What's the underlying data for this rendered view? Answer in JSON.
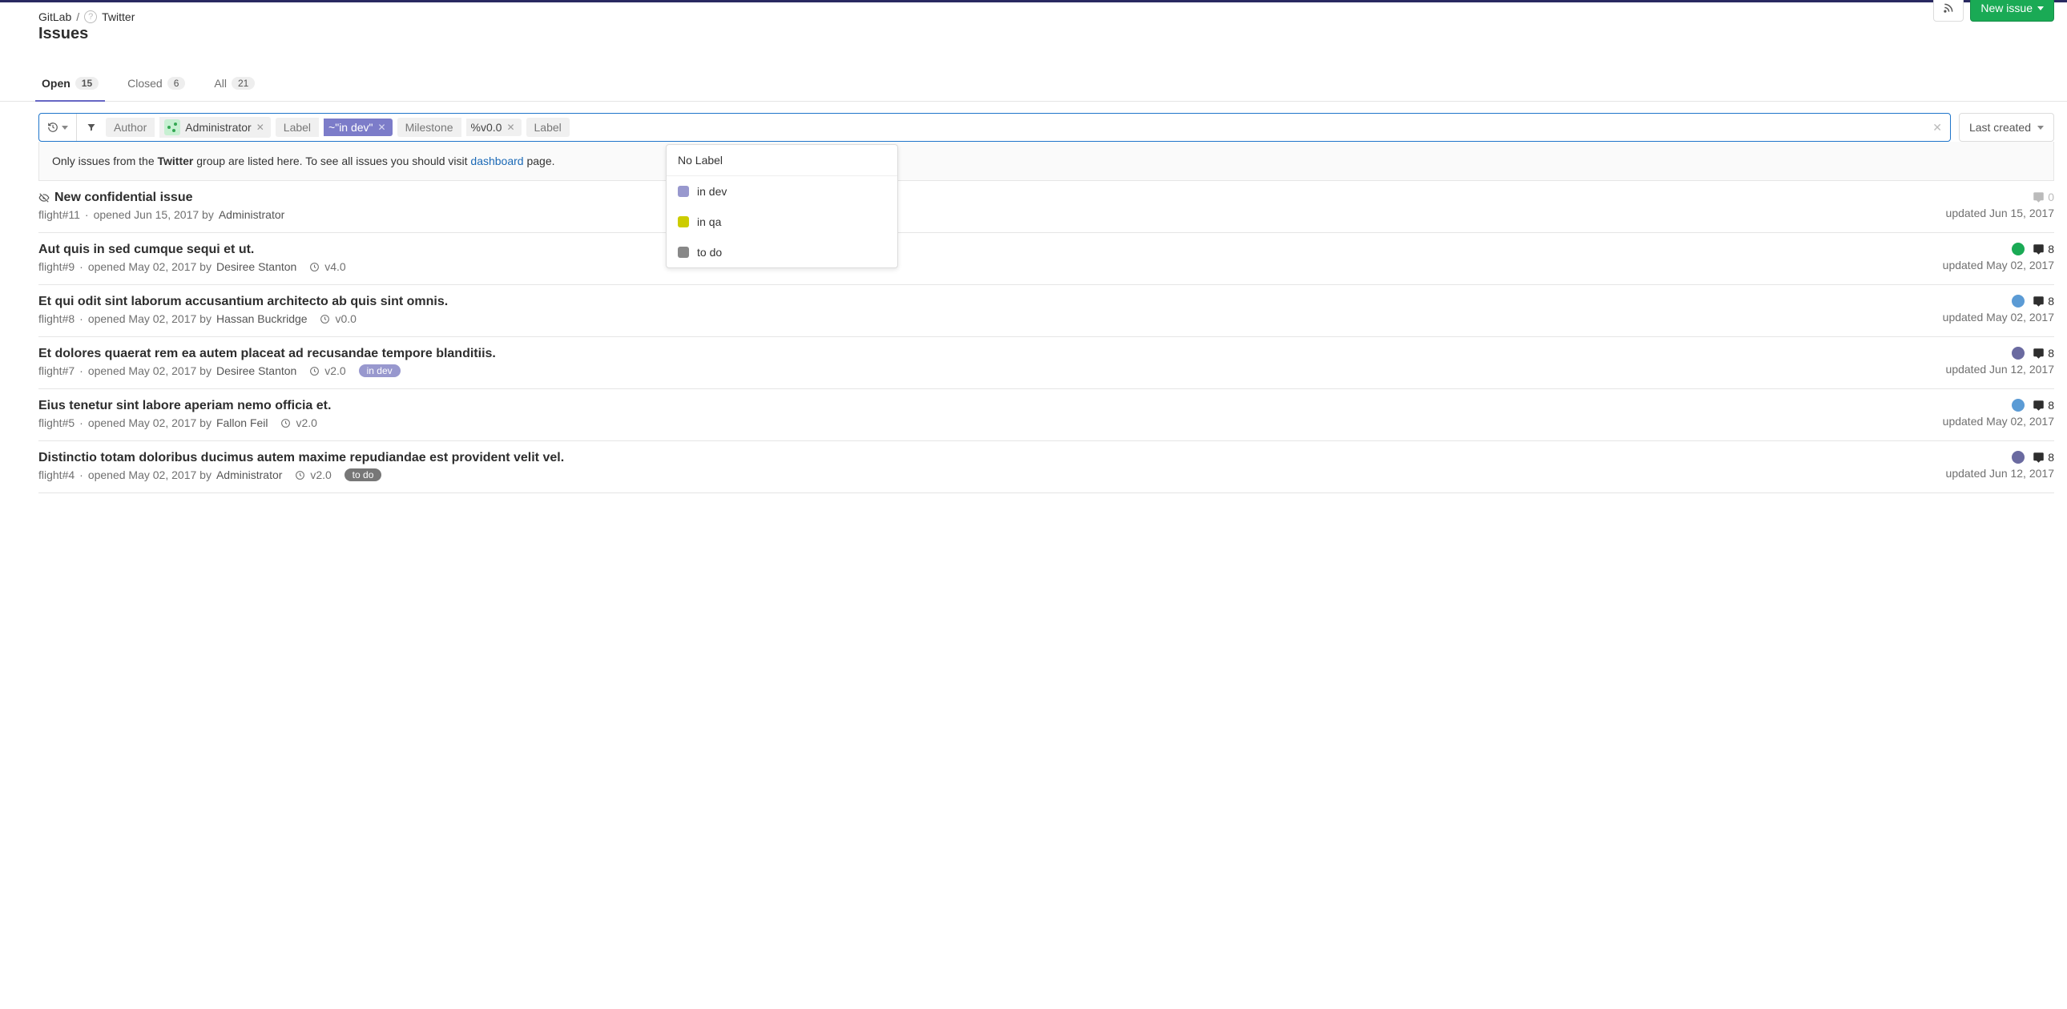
{
  "breadcrumb": {
    "root": "GitLab",
    "group": "Twitter"
  },
  "page_title": "Issues",
  "header_actions": {
    "new_issue": "New issue"
  },
  "tabs": [
    {
      "label": "Open",
      "count": "15",
      "active": true
    },
    {
      "label": "Closed",
      "count": "6",
      "active": false
    },
    {
      "label": "All",
      "count": "21",
      "active": false
    }
  ],
  "filter": {
    "tokens": [
      {
        "label": "Author",
        "value": "Administrator",
        "style": "avatar"
      },
      {
        "label": "Label",
        "value": "~\"in dev\"",
        "style": "purple"
      },
      {
        "label": "Milestone",
        "value": "%v0.0",
        "style": "plain"
      }
    ],
    "trailing_label": "Label",
    "sort": "Last created"
  },
  "dropdown": {
    "nolabel": "No Label",
    "items": [
      {
        "color": "#9898ce",
        "label": "in dev"
      },
      {
        "color": "#cccc00",
        "label": "in qa"
      },
      {
        "color": "#888888",
        "label": "to do"
      }
    ]
  },
  "notice": {
    "pre": "Only issues from the ",
    "bold": "Twitter",
    "mid": " group are listed here. To see all issues you should visit ",
    "link": "dashboard",
    "post": " page."
  },
  "issues": [
    {
      "confidential": true,
      "title": "New confidential issue",
      "ref": "flight#11",
      "opened": "opened Jun 15, 2017 by",
      "author": "Administrator",
      "milestone": "",
      "labels": [],
      "comments": "0",
      "updated": "updated Jun 15, 2017",
      "assignee": "",
      "comment_color": "#bbb"
    },
    {
      "confidential": false,
      "title": "Aut quis in sed cumque sequi et ut.",
      "ref": "flight#9",
      "opened": "opened May 02, 2017 by",
      "author": "Desiree Stanton",
      "milestone": "v4.0",
      "labels": [],
      "comments": "8",
      "updated": "updated May 02, 2017",
      "assignee": "#1aaa55",
      "comment_color": "#2e2e2e"
    },
    {
      "confidential": false,
      "title": "Et qui odit sint laborum accusantium architecto ab quis sint omnis.",
      "ref": "flight#8",
      "opened": "opened May 02, 2017 by",
      "author": "Hassan Buckridge",
      "milestone": "v0.0",
      "labels": [],
      "comments": "8",
      "updated": "updated May 02, 2017",
      "assignee": "#5b9bd5",
      "comment_color": "#2e2e2e"
    },
    {
      "confidential": false,
      "title": "Et dolores quaerat rem ea autem placeat ad recusandae tempore blanditiis.",
      "ref": "flight#7",
      "opened": "opened May 02, 2017 by",
      "author": "Desiree Stanton",
      "milestone": "v2.0",
      "labels": [
        "in dev"
      ],
      "comments": "8",
      "updated": "updated Jun 12, 2017",
      "assignee": "#6a6aa0",
      "comment_color": "#2e2e2e"
    },
    {
      "confidential": false,
      "title": "Eius tenetur sint labore aperiam nemo officia et.",
      "ref": "flight#5",
      "opened": "opened May 02, 2017 by",
      "author": "Fallon Feil",
      "milestone": "v2.0",
      "labels": [],
      "comments": "8",
      "updated": "updated May 02, 2017",
      "assignee": "#5b9bd5",
      "comment_color": "#2e2e2e"
    },
    {
      "confidential": false,
      "title": "Distinctio totam doloribus ducimus autem maxime repudiandae est provident velit vel.",
      "ref": "flight#4",
      "opened": "opened May 02, 2017 by",
      "author": "Administrator",
      "milestone": "v2.0",
      "labels": [
        "to do"
      ],
      "comments": "8",
      "updated": "updated Jun 12, 2017",
      "assignee": "#6a6aa0",
      "comment_color": "#2e2e2e"
    }
  ]
}
